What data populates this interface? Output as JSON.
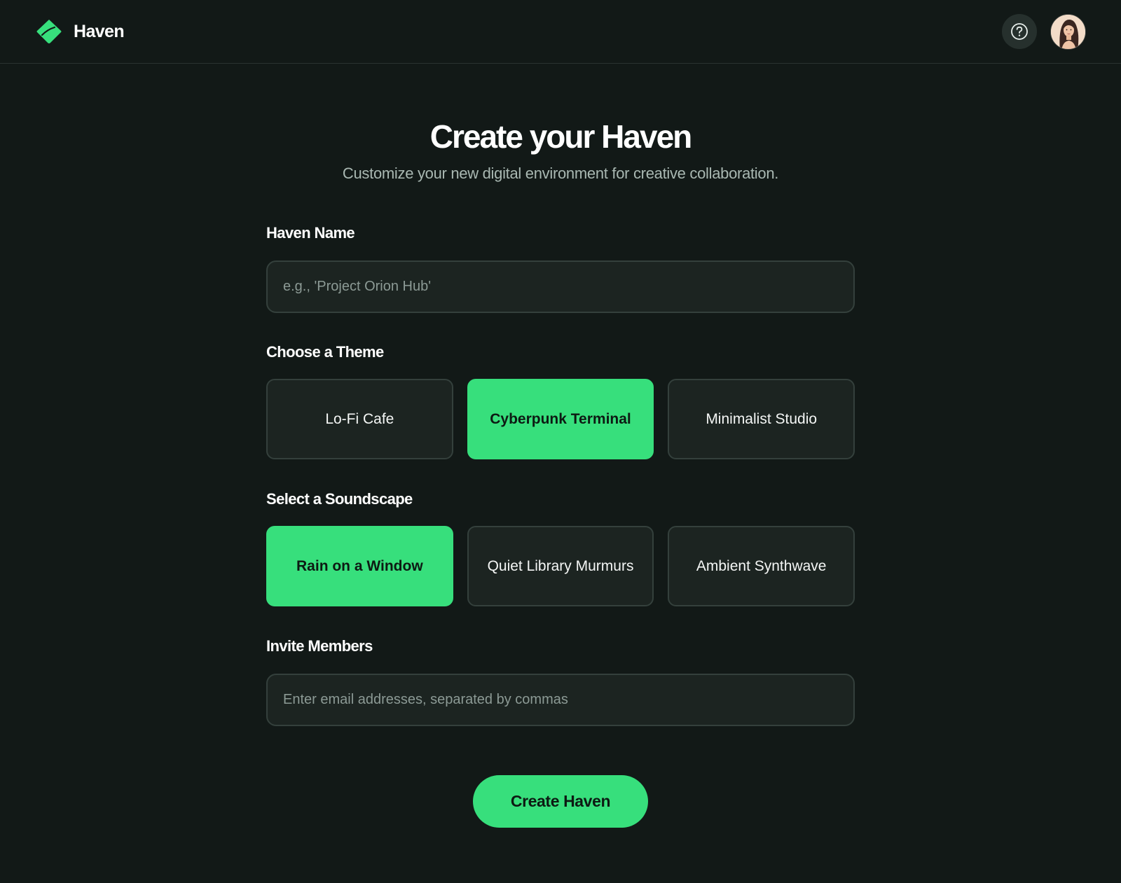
{
  "header": {
    "brand_name": "Haven",
    "logo_icon": "leaf-logo-icon",
    "help_icon": "question-mark-icon",
    "avatar_icon": "user-avatar",
    "accent_color": "#37df7c"
  },
  "page": {
    "title": "Create your Haven",
    "subtitle": "Customize your new digital environment for creative collaboration."
  },
  "haven_name": {
    "label": "Haven Name",
    "value": "",
    "placeholder": "e.g., 'Project Orion Hub'"
  },
  "theme": {
    "label": "Choose a Theme",
    "options": [
      {
        "label": "Lo-Fi Cafe",
        "selected": false
      },
      {
        "label": "Cyberpunk Terminal",
        "selected": true
      },
      {
        "label": "Minimalist Studio",
        "selected": false
      }
    ]
  },
  "soundscape": {
    "label": "Select a Soundscape",
    "options": [
      {
        "label": "Rain on a Window",
        "selected": true
      },
      {
        "label": "Quiet Library Murmurs",
        "selected": false
      },
      {
        "label": "Ambient Synthwave",
        "selected": false
      }
    ]
  },
  "invite": {
    "label": "Invite Members",
    "value": "",
    "placeholder": "Enter email addresses, separated by commas"
  },
  "submit": {
    "label": "Create Haven"
  }
}
